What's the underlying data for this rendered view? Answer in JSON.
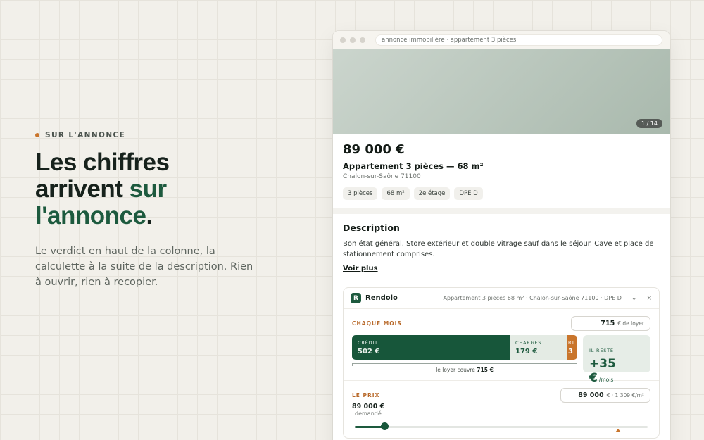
{
  "hero": {
    "eyebrow": "SUR L'ANNONCE",
    "headline_line1": "Les chiffres",
    "headline_line2a": "arrivent ",
    "headline_line2b": "sur",
    "headline_line3a": "l'annonce",
    "headline_line3b": ".",
    "lede": "Le verdict en haut de la colonne, la calculette à la suite de la description. Rien à ouvrir, rien à recopier."
  },
  "browser": {
    "url": "annonce immobilière · appartement 3 pièces",
    "photo_count": "1 / 14"
  },
  "listing": {
    "price": "89 000 €",
    "title": "Appartement 3 pièces — 68 m²",
    "city": "Chalon-sur-Saône 71100",
    "chips": [
      "3 pièces",
      "68 m²",
      "2e étage",
      "DPE D"
    ]
  },
  "description": {
    "heading": "Description",
    "text": "Bon état général. Store extérieur et double vitrage sauf dans le séjour. Cave et place de stationnement comprises.",
    "more": "Voir plus"
  },
  "widget": {
    "logo": "R",
    "brand": "Rendolo",
    "summary": "Appartement 3 pièces 68 m² · Chalon-sur-Saône 71100 · DPE D",
    "collapse": "⌄",
    "close": "×",
    "monthly": {
      "label": "CHAQUE MOIS",
      "rent_value": "715",
      "rent_unit": "€ de loyer",
      "credit_label": "CRÉDIT",
      "credit_value": "502 €",
      "charges_label": "CHARGES",
      "charges_value": "179 €",
      "other_label": "RT",
      "other_value": "3",
      "cover_text": "le loyer couvre ",
      "cover_value": "715 €",
      "remaining_label": "IL RESTE",
      "remaining_value": "+35 €",
      "remaining_unit": "/mois"
    },
    "price": {
      "label": "LE PRIX",
      "field_value": "89 000",
      "field_unit": "€ · 1 309 €/m²",
      "asked_value": "89 000 €",
      "asked_label": "demandé",
      "slider_level": 0.1
    }
  },
  "colors": {
    "accent_green": "#1d5a3e",
    "accent_orange": "#c9752c"
  }
}
